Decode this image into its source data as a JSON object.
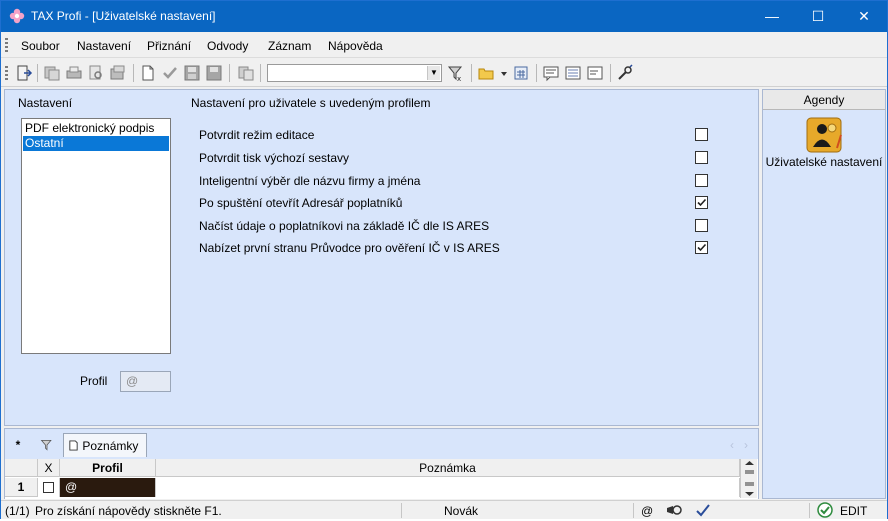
{
  "window": {
    "title": "TAX Profi - [Uživatelské nastavení]",
    "minimize": "—",
    "maximize": "☐",
    "close": "✕"
  },
  "menu": [
    "Soubor",
    "Nastavení",
    "Přiznání",
    "Odvody",
    "Záznam",
    "Nápověda"
  ],
  "toolbar": {
    "combo_value": ""
  },
  "left": {
    "header": "Nastavení",
    "items": [
      "PDF elektronický podpis",
      "Ostatní"
    ],
    "selected": "Ostatní",
    "profil_label": "Profil",
    "profil_value": "@"
  },
  "settings": {
    "header": "Nastavení pro uživatele s uvedeným profilem",
    "rows": [
      {
        "label": "Potvrdit režim editace",
        "checked": false
      },
      {
        "label": "Potvrdit tisk výchozí sestavy",
        "checked": false
      },
      {
        "label": "Inteligentní výběr dle názvu firmy a jména",
        "checked": false
      },
      {
        "label": "Po spuštění otevřít Adresář poplatníků",
        "checked": true
      },
      {
        "label": "Načíst údaje o poplatníkovi na základě IČ dle IS ARES",
        "checked": false
      },
      {
        "label": "Nabízet první stranu Průvodce pro ověření IČ v IS ARES",
        "checked": true
      }
    ]
  },
  "agendy": {
    "title": "Agendy",
    "item_label": "Uživatelské nastavení"
  },
  "bottom": {
    "tab_star": "*",
    "tab_notes": "Poznámky",
    "nav_prev": "‹",
    "nav_next": "›",
    "columns": {
      "x": "X",
      "profil": "Profil",
      "poznamka": "Poznámka"
    },
    "rows": [
      {
        "num": "1",
        "profil": "@",
        "poznamka": ""
      }
    ]
  },
  "status": {
    "page": "(1/1)",
    "help": "Pro získání nápovědy stiskněte F1.",
    "state": "Novák",
    "at": "@",
    "mode": "EDIT"
  }
}
